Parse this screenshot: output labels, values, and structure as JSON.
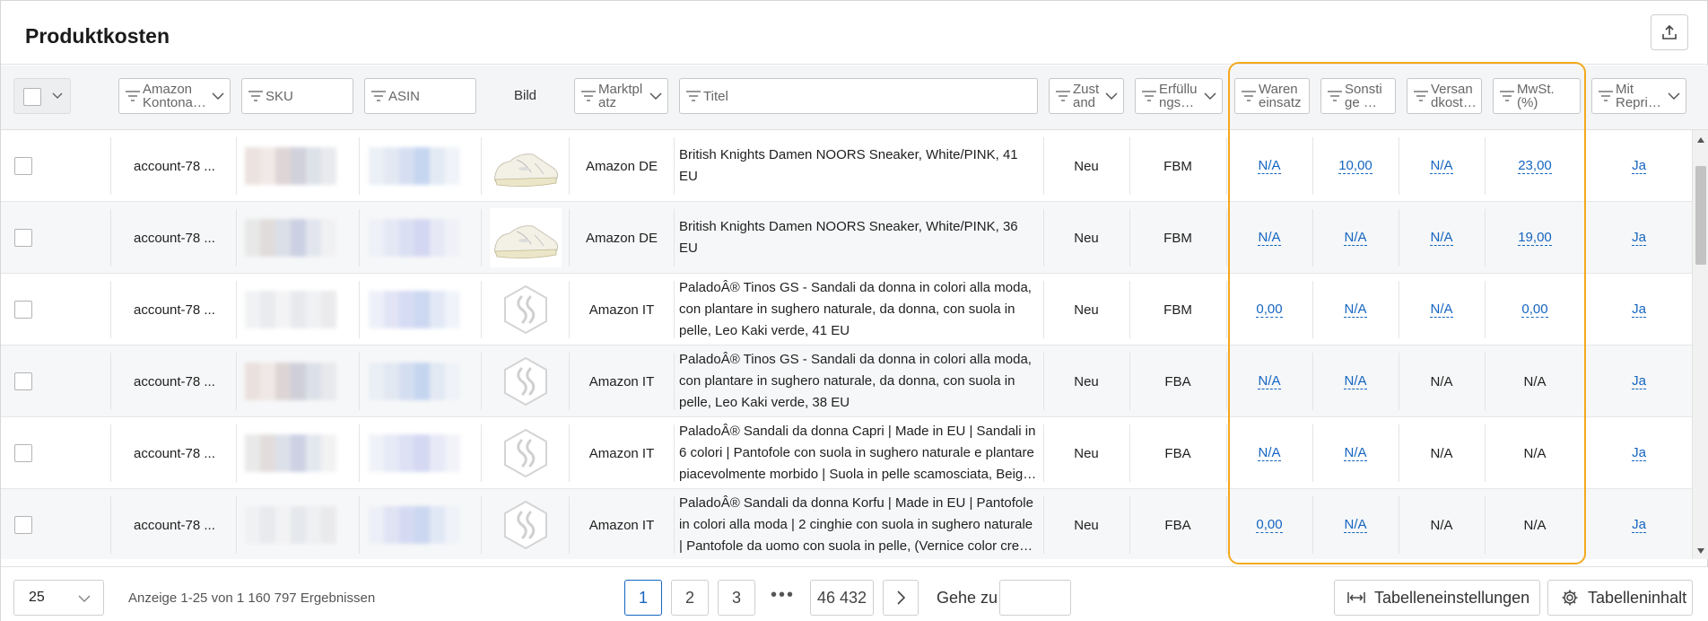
{
  "page": {
    "title": "Produktkosten"
  },
  "columns": {
    "account": "Amazon\nKontona…",
    "sku": "SKU",
    "asin": "ASIN",
    "bild": "Bild",
    "marketplace": "Marktpl\natz",
    "title": "Titel",
    "condition": "Zust\nand",
    "fulfillment": "Erfüllu\nngs…",
    "cost_of_goods": "Waren\neinsatz",
    "other": "Sonsti\nge …",
    "shipping": "Versan\ndkost…",
    "vat": "MwSt.\n(%)",
    "repricing": "Mit\nRepri…"
  },
  "rows": [
    {
      "account": "account-78 ...",
      "marketplace": "Amazon DE",
      "title": "British Knights Damen NOORS Sneaker, White/PINK, 41 EU",
      "condition": "Neu",
      "fulfillment": "FBM",
      "cost_of_goods": "N/A",
      "cost_of_goods_link": true,
      "other": "10,00",
      "other_link": true,
      "shipping": "N/A",
      "shipping_link": true,
      "vat": "23,00",
      "vat_link": true,
      "repricing": "Ja",
      "image": "sneaker"
    },
    {
      "account": "account-78 ...",
      "marketplace": "Amazon DE",
      "title": "British Knights Damen NOORS Sneaker, White/PINK, 36 EU",
      "condition": "Neu",
      "fulfillment": "FBM",
      "cost_of_goods": "N/A",
      "cost_of_goods_link": true,
      "other": "N/A",
      "other_link": true,
      "shipping": "N/A",
      "shipping_link": true,
      "vat": "19,00",
      "vat_link": true,
      "repricing": "Ja",
      "image": "sneaker"
    },
    {
      "account": "account-78 ...",
      "marketplace": "Amazon IT",
      "title": "PaladoÂ® Tinos GS - Sandali da donna in colori alla moda, con plantare in sughero naturale, da donna, con suola in pelle, Leo Kaki verde, 41 EU",
      "condition": "Neu",
      "fulfillment": "FBM",
      "cost_of_goods": "0,00",
      "cost_of_goods_link": true,
      "other": "N/A",
      "other_link": true,
      "shipping": "N/A",
      "shipping_link": true,
      "vat": "0,00",
      "vat_link": true,
      "repricing": "Ja",
      "image": "logo"
    },
    {
      "account": "account-78 ...",
      "marketplace": "Amazon IT",
      "title": "PaladoÂ® Tinos GS - Sandali da donna in colori alla moda, con plantare in sughero naturale, da donna, con suola in pelle, Leo Kaki verde, 38 EU",
      "condition": "Neu",
      "fulfillment": "FBA",
      "cost_of_goods": "N/A",
      "cost_of_goods_link": true,
      "other": "N/A",
      "other_link": true,
      "shipping": "N/A",
      "shipping_link": false,
      "vat": "N/A",
      "vat_link": false,
      "repricing": "Ja",
      "image": "logo"
    },
    {
      "account": "account-78 ...",
      "marketplace": "Amazon IT",
      "title": "PaladoÂ® Sandali da donna Capri | Made in EU | Sandali in 6 colori | Pantofole con suola in sughero naturale e plantare piacevolmente morbido | Suola in pelle scamosciata, Beig…",
      "condition": "Neu",
      "fulfillment": "FBA",
      "cost_of_goods": "N/A",
      "cost_of_goods_link": true,
      "other": "N/A",
      "other_link": true,
      "shipping": "N/A",
      "shipping_link": false,
      "vat": "N/A",
      "vat_link": false,
      "repricing": "Ja",
      "image": "logo"
    },
    {
      "account": "account-78 ...",
      "marketplace": "Amazon IT",
      "title": "PaladoÂ® Sandali da donna Korfu | Made in EU | Pantofole in colori alla moda | 2 cinghie con suola in sughero naturale | Pantofole da uomo con suola in pelle, (Vernice color cre…",
      "condition": "Neu",
      "fulfillment": "FBA",
      "cost_of_goods": "0,00",
      "cost_of_goods_link": true,
      "other": "N/A",
      "other_link": true,
      "shipping": "N/A",
      "shipping_link": false,
      "vat": "N/A",
      "vat_link": false,
      "repricing": "Ja",
      "image": "logo"
    }
  ],
  "footer": {
    "per_page": "25",
    "results_text": "Anzeige 1-25 von 1 160 797 Ergebnissen",
    "pages": [
      "1",
      "2",
      "3"
    ],
    "dots": "•••",
    "last_page": "46 432",
    "goto_label": "Gehe zu",
    "table_settings": "Tabelleneinstellungen",
    "table_content": "Tabelleninhalt"
  },
  "colors": {
    "accent": "#1565c0",
    "highlight": "#f3a91f",
    "header_bg": "#f4f5f6"
  },
  "icons": [
    "export-icon",
    "filter-icon",
    "chevron-down-icon",
    "chevron-right-icon",
    "column-width-icon",
    "gear-icon",
    "palado-logo-icon",
    "sneaker-image"
  ]
}
